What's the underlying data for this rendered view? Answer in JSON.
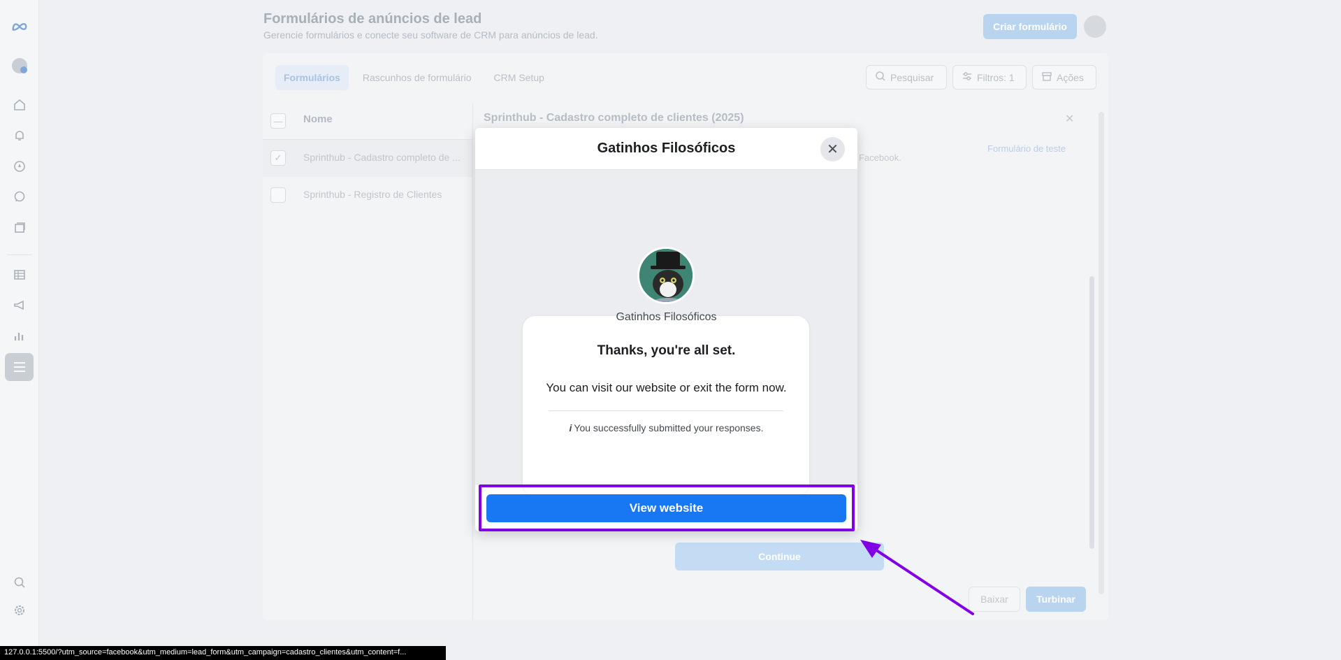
{
  "page": {
    "title": "Formulários de anúncios de lead",
    "subtitle": "Gerencie formulários e conecte seu software de CRM para anúncios de lead.",
    "create_button": "Criar formulário"
  },
  "tabs": [
    {
      "label": "Formulários",
      "active": true
    },
    {
      "label": "Rascunhos de formulário",
      "active": false
    },
    {
      "label": "CRM Setup",
      "active": false
    }
  ],
  "toolbar": {
    "search": "Pesquisar",
    "filters": "Filtros: 1",
    "actions": "Ações"
  },
  "list": {
    "column_header": "Nome",
    "rows": [
      {
        "name": "Sprinthub - Cadastro completo de ...",
        "checked": true
      },
      {
        "name": "Sprinthub - Registro de Clientes",
        "checked": false
      }
    ]
  },
  "detail": {
    "title": "Sprinthub - Cadastro completo de clientes (2025)",
    "test_link": "Formulário de teste",
    "fb_text": "Facebook.",
    "continue": "Continue",
    "download": "Baixar",
    "boost": "Turbinar"
  },
  "modal": {
    "title": "Gatinhos Filosóficos",
    "page_name": "Gatinhos Filosóficos",
    "heading": "Thanks, you're all set.",
    "description": "You can visit our website or exit the form now.",
    "info_icon": "i",
    "note": "You successfully submitted your responses.",
    "view_button": "View website"
  },
  "status_bar": "127.0.0.1:5500/?utm_source=facebook&utm_medium=lead_form&utm_campaign=cadastro_clientes&utm_content=f...",
  "colors": {
    "primary": "#1877f2",
    "highlight": "#8200e6"
  }
}
